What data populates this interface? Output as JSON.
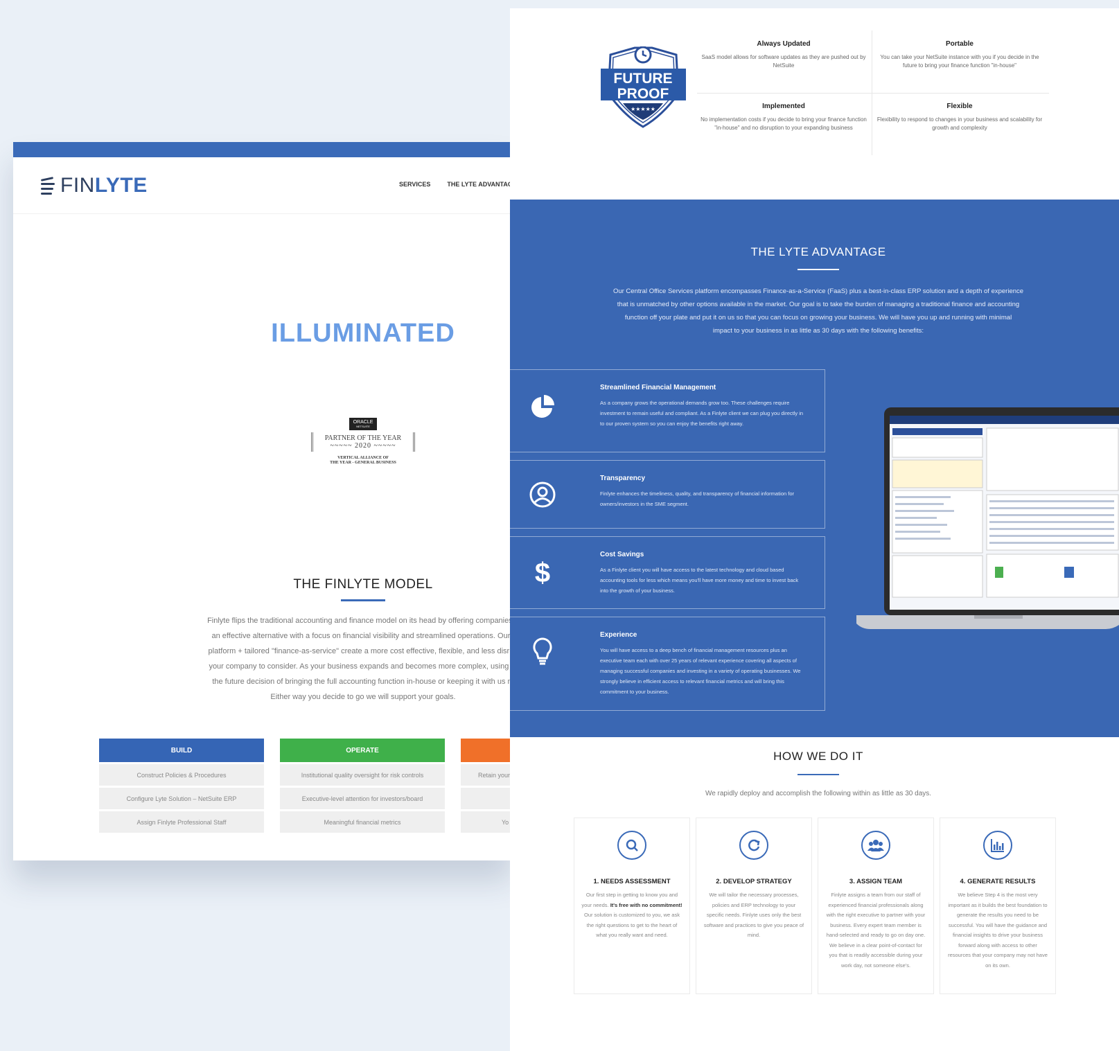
{
  "left": {
    "logo": {
      "part1": "FIN",
      "part2": "LYTE"
    },
    "nav": [
      "SERVICES",
      "THE LYTE ADVANTAGE"
    ],
    "hero_title": "ILLUMINATED",
    "badge": {
      "oracle": "ORACLE",
      "netsuite": "NETSUITE",
      "line1": "PARTNER OF THE YEAR",
      "year": "2020",
      "sub1": "VERTICAL ALLIANCE OF",
      "sub2": "THE YEAR - GENERAL BUSINESS"
    },
    "model_title": "THE FINLYTE MODEL",
    "model_lines": [
      "Finlyte flips the traditional accounting and finance model on its head by offering companies a",
      "an effective alternative with a focus on financial visibility and streamlined operations. Our t",
      "platform + tailored \"finance-as-service\" create a more cost effective, flexible, and less disrup",
      "your company to consider. As your business expands and becomes more complex, using Fi",
      "the future decision of bringing the full accounting function in-house or keeping it with us m",
      "Either way you decide to go we will support your goals."
    ],
    "columns": [
      {
        "head": "BUILD",
        "color": "#3565b5",
        "cells": [
          "Construct Policies & Procedures",
          "Configure Lyte Solution – NetSuite ERP",
          "Assign Finlyte Professional Staff"
        ]
      },
      {
        "head": "OPERATE",
        "color": "#3fb04a",
        "cells": [
          "Institutional quality oversight for risk controls",
          "Executive-level attention for investors/board",
          "Meaningful financial metrics"
        ]
      },
      {
        "head": "",
        "color": "#f07029",
        "cells": [
          "Retain your",
          "",
          "Yo"
        ]
      }
    ]
  },
  "right": {
    "future_badge": {
      "line1": "FUTURE",
      "line2": "PROOF",
      "stars": "★★★★★"
    },
    "features": [
      {
        "title": "Always Updated",
        "text": "SaaS model allows for software updates as they are pushed out by NetSuite"
      },
      {
        "title": "Portable",
        "text": "You can take your NetSuite instance with you if you decide in the future to bring your finance function \"in-house\""
      },
      {
        "title": "Implemented",
        "text": "No implementation costs if you decide to bring your finance function \"in-house\" and no disruption to your expanding business"
      },
      {
        "title": "Flexible",
        "text": "Flexibility to respond to changes in your business and scalability for growth and complexity"
      }
    ],
    "advantage_title": "THE LYTE ADVANTAGE",
    "advantage_lines": [
      "Our Central Office Services platform encompasses Finance-as-a-Service (FaaS) plus a best-in-class ERP solution and a depth of experience",
      "that is unmatched by other options available in the market. Our goal is to take the burden of managing a traditional finance and accounting",
      "function off your plate and put it on us so that you can focus on growing your business. We will have you up and running with minimal",
      "impact to your business in as little as 30 days with the following benefits:"
    ],
    "benefits": [
      {
        "title": "Streamlined Financial Management",
        "icon": "pie-chart-icon",
        "text": "As a company grows the operational demands grow too. These challenges require investment to remain useful and compliant. As a Finlyte client we can plug you directly in to our proven system so you can enjoy the benefits right away."
      },
      {
        "title": "Transparency",
        "icon": "user-circle-icon",
        "text": "Finlyte enhances the timeliness, quality, and transparency of financial information for owners/investors in the SME segment."
      },
      {
        "title": "Cost Savings",
        "icon": "dollar-icon",
        "text": "As a Finlyte client you will have access to the latest technology and cloud based accounting tools for less which means you'll have more money and time to invest back into the growth of your business."
      },
      {
        "title": "Experience",
        "icon": "lightbulb-icon",
        "text": "You will have access to a deep bench of financial management resources plus an executive team each with over 25 years of relevant experience covering all aspects of managing successful companies and investing in a variety of operating businesses. We strongly believe in efficient access to relevant financial metrics and will bring this commitment to your business."
      }
    ],
    "how_title": "HOW WE DO IT",
    "how_sub": "We rapidly deploy and accomplish the following within as little as 30 days.",
    "steps": [
      {
        "title": "1. NEEDS ASSESSMENT",
        "icon": "search-icon",
        "pre": "Our first step in getting to know you and your needs. ",
        "bold": "It's free with no commitment!",
        "post": " Our solution is customized to you, we ask the right questions to get to the heart of what you really want and need."
      },
      {
        "title": "2. DEVELOP STRATEGY",
        "icon": "refresh-icon",
        "pre": "We will tailor the necessary processes, policies and ERP technology to your specific needs. Finlyte uses only the best software and practices to give you peace of mind.",
        "bold": "",
        "post": ""
      },
      {
        "title": "3. ASSIGN TEAM",
        "icon": "team-icon",
        "pre": "Finlyte assigns a team from our staff of experienced financial professionals along with the right executive to partner with your business. Every expert team member is hand-selected and ready to go on day one. We believe in a clear point-of-contact for you that is readily accessible during your work day, not someone else's.",
        "bold": "",
        "post": ""
      },
      {
        "title": "4. GENERATE RESULTS",
        "icon": "bar-chart-icon",
        "pre": "We believe Step 4 is the most very important as it builds the best foundation to generate the results you need to be successful. You will have the guidance and financial insights to drive your business forward along with access to other resources that your company may not have on its own.",
        "bold": "",
        "post": ""
      }
    ]
  }
}
